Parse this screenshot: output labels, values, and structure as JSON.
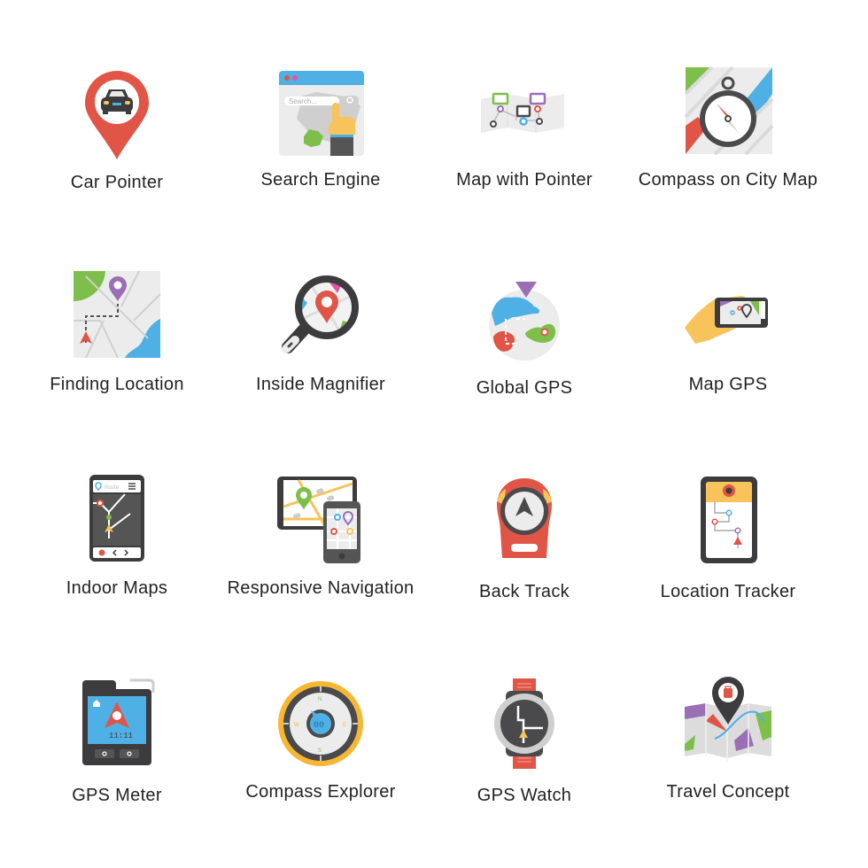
{
  "icons": [
    {
      "label": "Car Pointer",
      "icon": "car-pointer-icon"
    },
    {
      "label": "Search Engine",
      "icon": "search-engine-icon",
      "search_placeholder": "Search..."
    },
    {
      "label": "Map with Pointer",
      "icon": "map-with-pointer-icon"
    },
    {
      "label": "Compass on City Map",
      "icon": "compass-city-map-icon"
    },
    {
      "label": "Finding Location",
      "icon": "finding-location-icon"
    },
    {
      "label": "Inside Magnifier",
      "icon": "inside-magnifier-icon"
    },
    {
      "label": "Global GPS",
      "icon": "global-gps-icon"
    },
    {
      "label": "Map GPS",
      "icon": "map-gps-icon"
    },
    {
      "label": "Indoor Maps",
      "icon": "indoor-maps-icon",
      "screen_text": "Route"
    },
    {
      "label": "Responsive Navigation",
      "icon": "responsive-navigation-icon"
    },
    {
      "label": "Back Track",
      "icon": "back-track-icon"
    },
    {
      "label": "Location Tracker",
      "icon": "location-tracker-icon"
    },
    {
      "label": "GPS Meter",
      "icon": "gps-meter-icon",
      "screen_text": "11:11"
    },
    {
      "label": "Compass Explorer",
      "icon": "compass-explorer-icon",
      "dial_text": "00",
      "directions": [
        "N",
        "E",
        "S",
        "W"
      ]
    },
    {
      "label": "GPS Watch",
      "icon": "gps-watch-icon"
    },
    {
      "label": "Travel Concept",
      "icon": "travel-concept-icon"
    }
  ],
  "colors": {
    "red": "#e05545",
    "dark": "#4a4a4c",
    "blue": "#4fb0e5",
    "green": "#7dbf4a",
    "yellow": "#f7c35a",
    "purple": "#9a6fb5",
    "light_gray": "#ececec",
    "text": "#222222"
  }
}
